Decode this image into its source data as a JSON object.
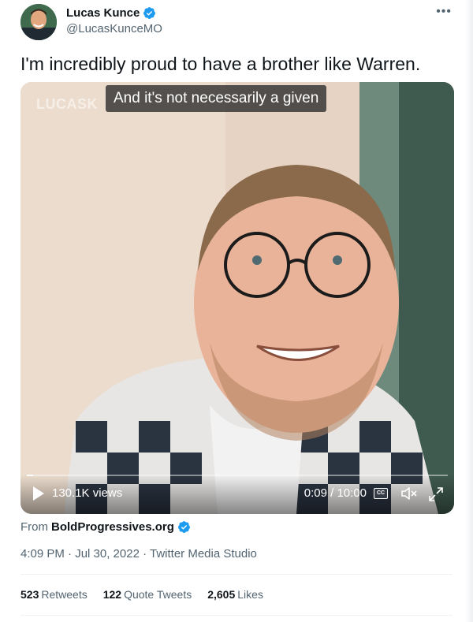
{
  "author": {
    "display_name": "Lucas Kunce",
    "handle": "@LucasKunceMO",
    "verified": true
  },
  "tweet": {
    "text": "I'm incredibly proud to have a brother like Warren."
  },
  "video": {
    "watermark": "LUCASK",
    "caption": "And it's not necessarily a given",
    "views": "130.1K views",
    "time": "0:09 / 10:00",
    "cc_label": "CC",
    "progress": 0.015
  },
  "source": {
    "prefix": "From",
    "name": "BoldProgressives.org",
    "verified": true
  },
  "meta": "4:09 PM · Jul 30, 2022 · Twitter Media Studio",
  "stats": {
    "retweets_count": "523",
    "retweets_label": "Retweets",
    "quotes_count": "122",
    "quotes_label": "Quote Tweets",
    "likes_count": "2,605",
    "likes_label": "Likes"
  },
  "icons": {
    "more": "more-dots-icon",
    "verified": "verified-badge-icon",
    "play": "play-icon",
    "cc": "closed-captions-icon",
    "mute": "mute-icon",
    "fullscreen": "fullscreen-icon"
  },
  "colors": {
    "verified_blue": "#1d9bf0",
    "text_primary": "#0f1419",
    "text_secondary": "#536471"
  }
}
